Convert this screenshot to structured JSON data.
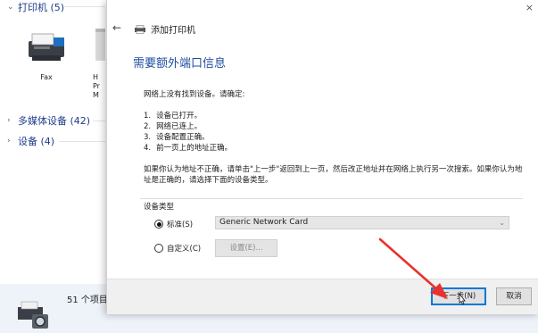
{
  "explorer": {
    "printers_group": "打印机 (5)",
    "multimedia_group": "多媒体设备 (42)",
    "devices_group": "设备 (4)",
    "fax_label": "Fax",
    "partial_label_1": "H",
    "partial_label_2": "Pr",
    "partial_label_3": "M",
    "status_text": "51 个项目"
  },
  "dialog": {
    "close_glyph": "×",
    "back_glyph": "←",
    "window_title": "添加打印机",
    "heading": "需要额外端口信息",
    "intro": "网络上没有找到设备。请确定:",
    "checks": [
      {
        "num": "1.",
        "text": "设备已打开。"
      },
      {
        "num": "2.",
        "text": "网络已连上。"
      },
      {
        "num": "3.",
        "text": "设备配置正确。"
      },
      {
        "num": "4.",
        "text": "前一页上的地址正确。"
      }
    ],
    "paragraph": "如果你认为地址不正确，请单击\"上一步\"返回到上一页，然后改正地址并在网络上执行另一次搜索。如果你认为地址是正确的，请选择下面的设备类型。",
    "device_type": {
      "label": "设备类型",
      "standard_label": "标准(S)",
      "standard_selected": true,
      "custom_label": "自定义(C)",
      "custom_selected": false,
      "select_value": "Generic Network Card",
      "settings_label": "设置(E)..."
    },
    "next_label": "下一步(N)",
    "cancel_label": "取消"
  },
  "colors": {
    "heading": "#1f4e9e",
    "link_group": "#1e3c8c",
    "primary_border": "#0078d7",
    "arrow": "#e8322e"
  }
}
